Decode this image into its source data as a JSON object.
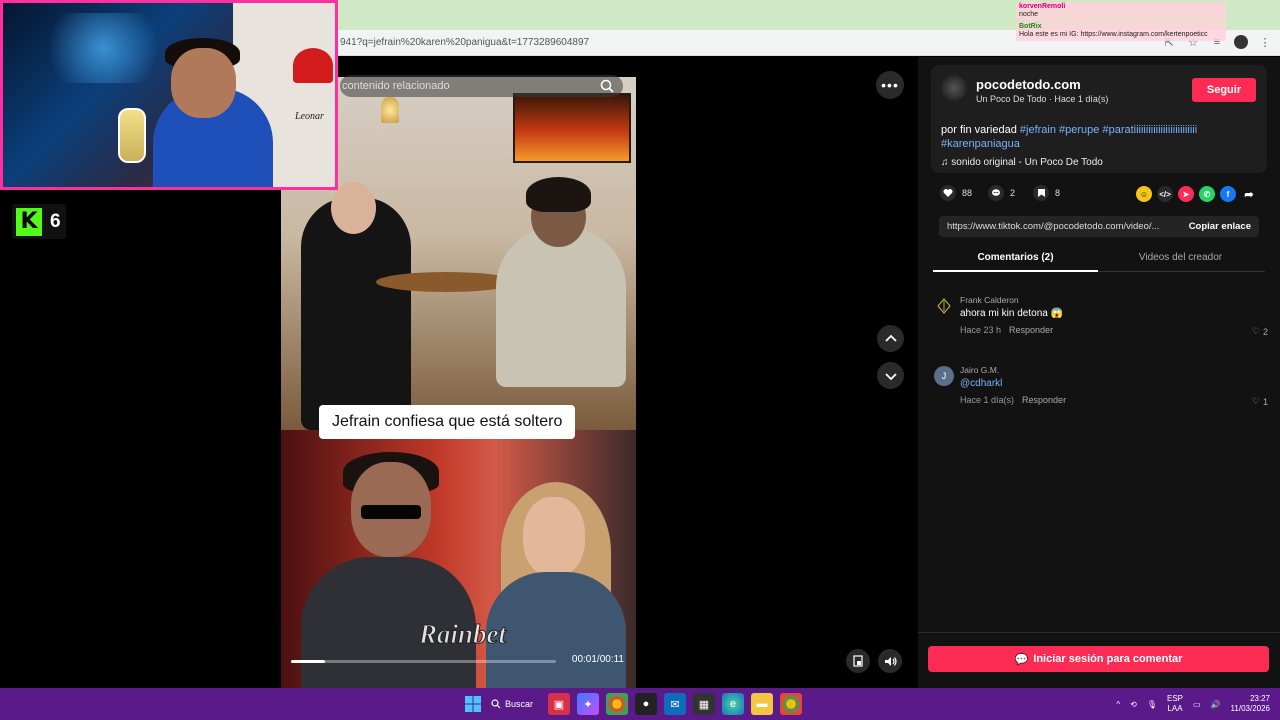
{
  "browser": {
    "url": "941?q=jefrain%20karen%20panigua&t=1773289604897"
  },
  "chat_overlay": [
    {
      "nick": "korvenRemoli",
      "text": "noche"
    },
    {
      "nick": "BotRix",
      "text": "Hola este es mi IG: https://www.instagram.com/kertenpoeticc"
    }
  ],
  "webcam": {
    "shirt_text": "Leonar"
  },
  "kick": {
    "logo": "K",
    "viewers": "6"
  },
  "video": {
    "search_placeholder": "contenido relacionado",
    "caption": "Jefrain confiesa que está soltero",
    "watermark": "Rainbet",
    "time": "00:01/00:11",
    "progress": 0.13
  },
  "post": {
    "author_name": "pocodetodo.com",
    "author_sub": "Un Poco De Todo · Hace 1 día(s)",
    "follow_label": "Seguir",
    "desc_text": "por fin variedad ",
    "tags": [
      "#jefrain",
      "#perupe",
      "#paratiiiiiiiiiiiiiiiiiiiiiiiiii",
      "#karenpaniagua"
    ],
    "sound": "sonido original - Un Poco De Todo"
  },
  "actions": {
    "likes": "88",
    "comments": "2",
    "saves": "8"
  },
  "share_link": {
    "url": "https://www.tiktok.com/@pocodetodo.com/video/...",
    "copy_label": "Copiar enlace"
  },
  "tabs": {
    "comments": "Comentarios (2)",
    "videos": "Videos del creador"
  },
  "comments": [
    {
      "name": "Frank Calderon",
      "text": "ahora mi kin detona 😱",
      "time": "Hace 23 h",
      "reply": "Responder",
      "likes": "2",
      "avatar": ""
    },
    {
      "name": "Jairo G.M.",
      "text": "@cdharkl",
      "time": "Hace 1 día(s)",
      "reply": "Responder",
      "likes": "1",
      "avatar": "J"
    }
  ],
  "login_label": "Iniciar sesión para comentar",
  "taskbar": {
    "search_label": "Buscar",
    "lang_top": "ESP",
    "lang_bottom": "LAA",
    "time": "23:27",
    "date": "11/03/2026"
  },
  "colors": {
    "accent": "#fe2c55",
    "taskbar": "#5a1a8a",
    "kick_green": "#53fc18",
    "webcam_border": "#ff2fa0"
  }
}
